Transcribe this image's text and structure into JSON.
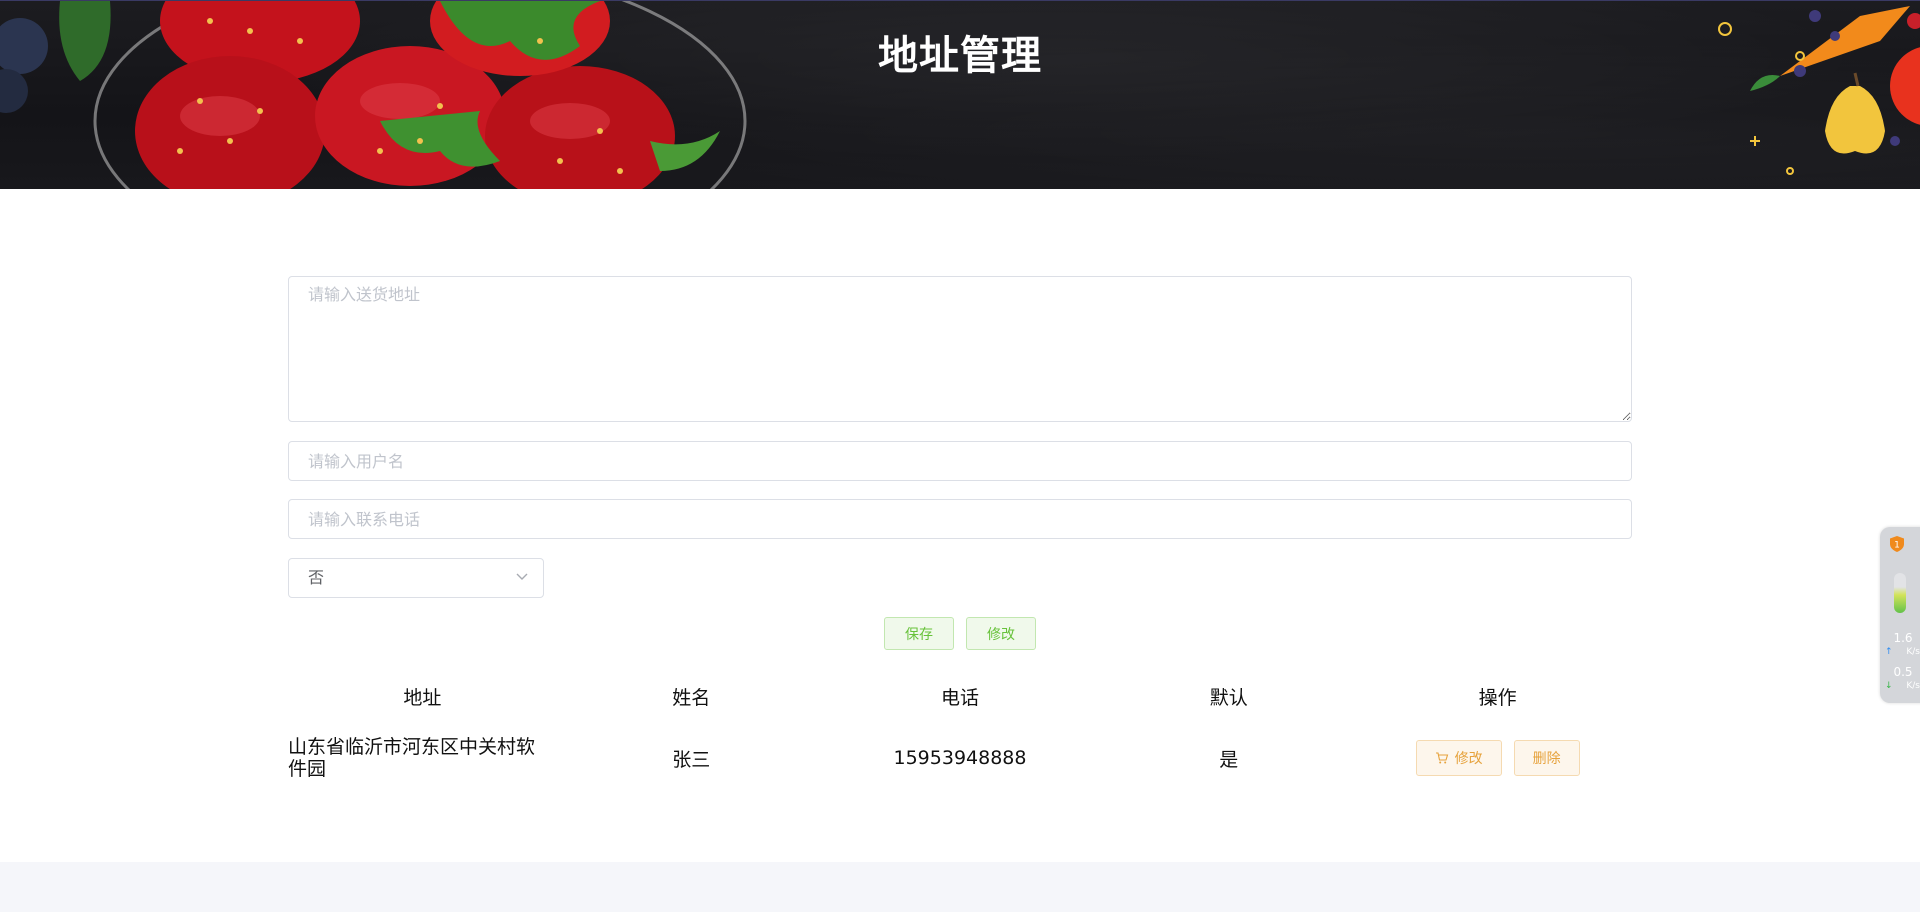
{
  "header": {
    "title": "地址管理"
  },
  "form": {
    "address_placeholder": "请输入送货地址",
    "username_placeholder": "请输入用户名",
    "phone_placeholder": "请输入联系电话",
    "default_select_value": "否",
    "save_label": "保存",
    "modify_label": "修改"
  },
  "table": {
    "columns": [
      "地址",
      "姓名",
      "电话",
      "默认",
      "操作"
    ],
    "rows": [
      {
        "address": "山东省临沂市河东区中关村软件园",
        "name": "张三",
        "phone": "15953948888",
        "default": "是",
        "edit_label": "修改",
        "delete_label": "删除"
      }
    ]
  },
  "widget": {
    "badge": "1",
    "upload_speed": "1.6",
    "download_speed": "0.5",
    "unit": "K/s"
  },
  "colors": {
    "green_button_text": "#67c23a",
    "orange_button_text": "#e6a23c",
    "banner_bg": "#141418"
  }
}
